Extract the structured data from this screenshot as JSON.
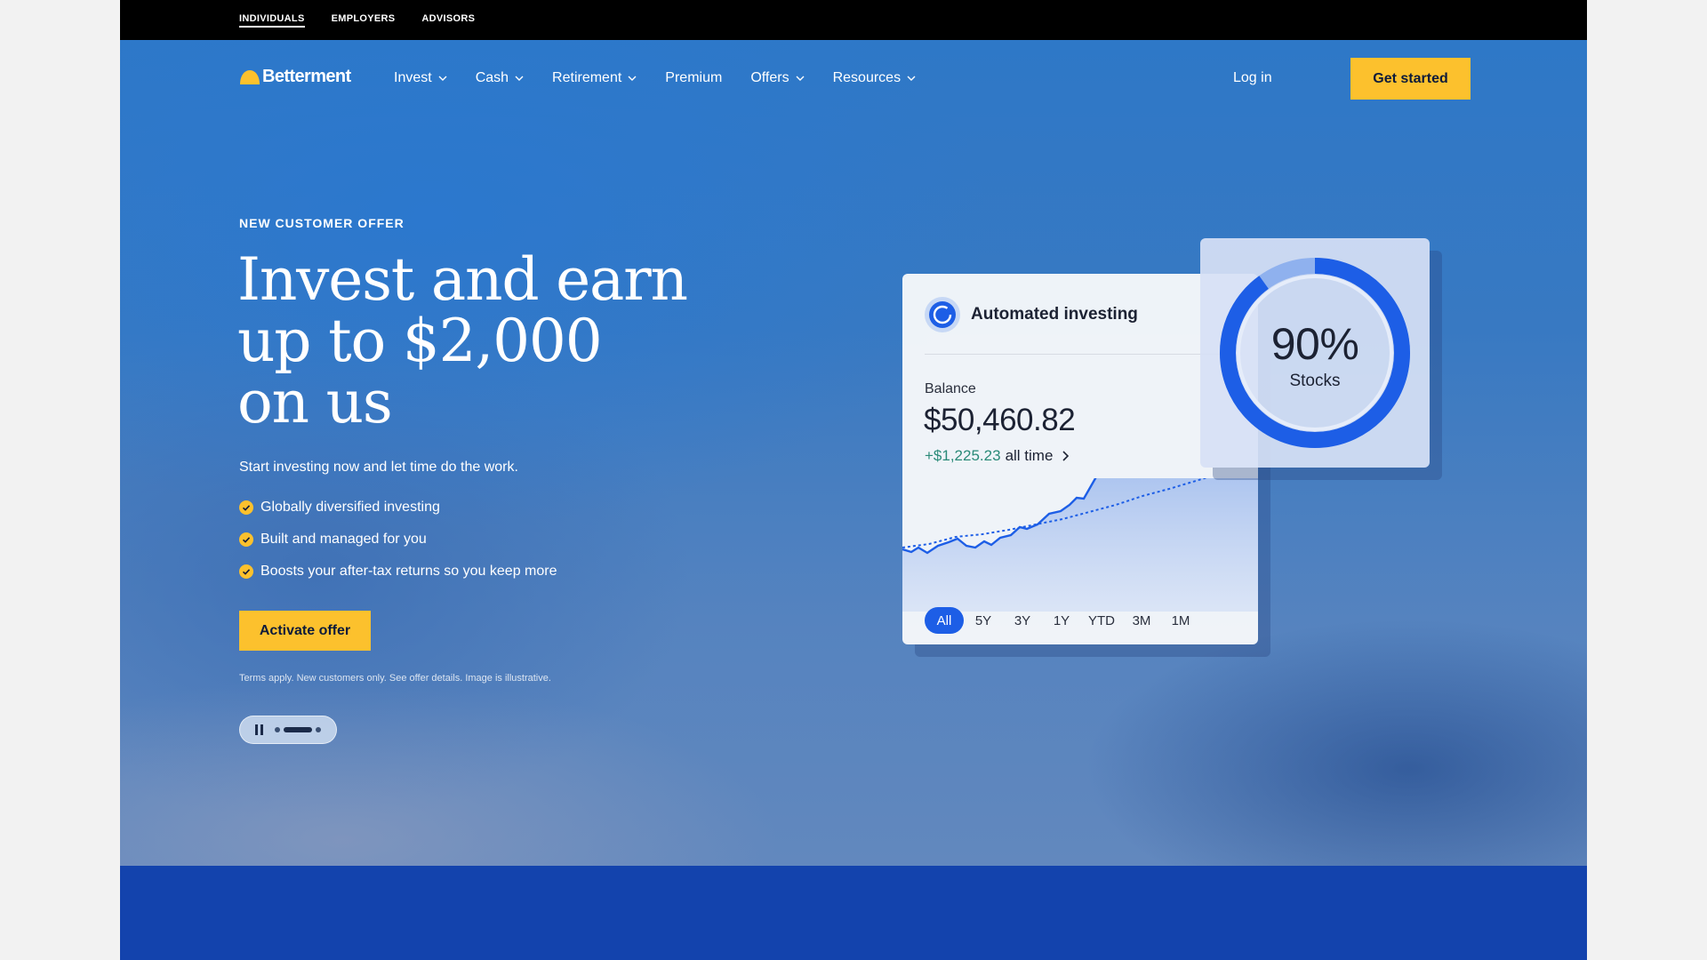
{
  "audience_bar": {
    "items": [
      {
        "label": "INDIVIDUALS",
        "active": true
      },
      {
        "label": "EMPLOYERS",
        "active": false
      },
      {
        "label": "ADVISORS",
        "active": false
      }
    ]
  },
  "nav": {
    "logo_text": "Betterment",
    "items": [
      {
        "label": "Invest",
        "has_dropdown": true
      },
      {
        "label": "Cash",
        "has_dropdown": true
      },
      {
        "label": "Retirement",
        "has_dropdown": true
      },
      {
        "label": "Premium",
        "has_dropdown": false
      },
      {
        "label": "Offers",
        "has_dropdown": true
      },
      {
        "label": "Resources",
        "has_dropdown": true
      }
    ],
    "login_label": "Log in",
    "cta_label": "Get started"
  },
  "hero": {
    "eyebrow": "NEW CUSTOMER OFFER",
    "headline_lines": [
      "Invest and earn",
      "up to $2,000",
      "on us"
    ],
    "subhead": "Start investing now and let time do the work.",
    "benefits": [
      "Globally diversified investing",
      "Built and managed for you",
      "Boosts your after-tax returns so you keep more"
    ],
    "cta_label": "Activate offer",
    "terms": "Terms apply. New customers only. See offer details. Image is illustrative.",
    "carousel": {
      "slide_count": 3,
      "active_index": 1
    }
  },
  "card": {
    "title": "Automated investing",
    "balance_label": "Balance",
    "balance_value": "$50,460.82",
    "gain_value": "+$1,225.23",
    "gain_suffix": "all time",
    "range_tabs": [
      "All",
      "5Y",
      "3Y",
      "1Y",
      "YTD",
      "3M",
      "1M"
    ],
    "active_range": "All"
  },
  "stocks_card": {
    "percent": "90%",
    "label": "Stocks",
    "fraction": 0.9
  },
  "colors": {
    "accent_yellow": "#fcc12d",
    "brand_blue": "#1d5ee6",
    "gain_green": "#2a8a78",
    "footer_band": "#1343ad"
  }
}
